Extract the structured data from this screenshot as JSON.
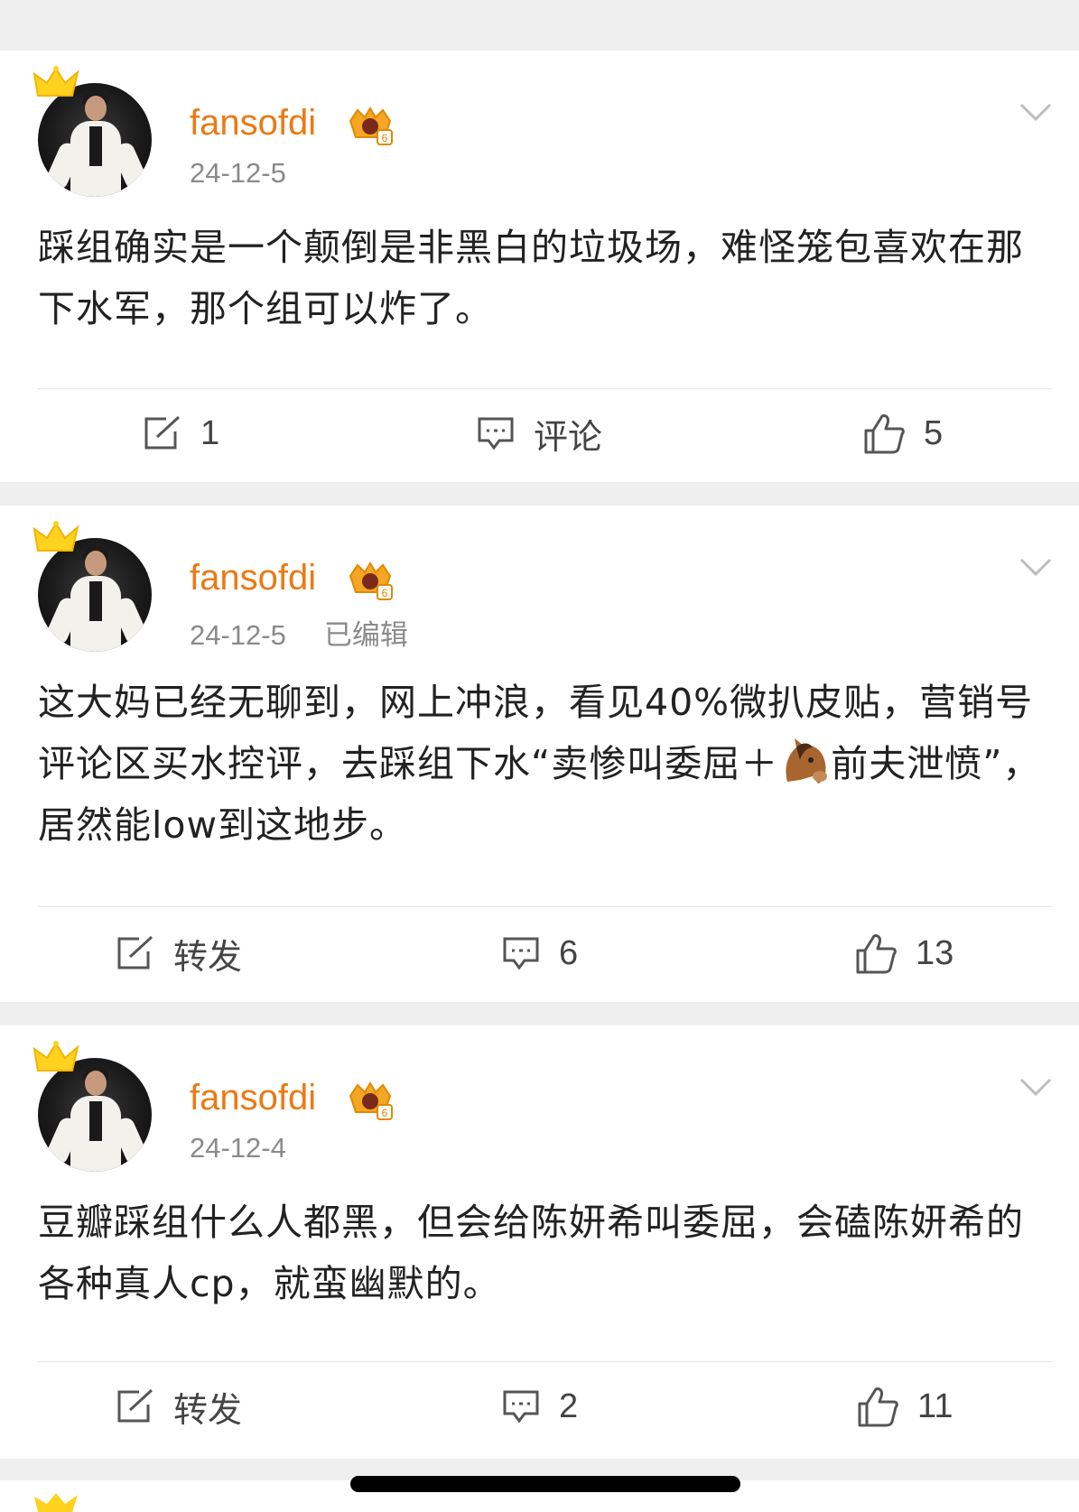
{
  "posts": [
    {
      "username": "fansofdi",
      "date": "24-12-5",
      "edited": "",
      "content": "踩组确实是一个颠倒是非黑白的垃圾场，难怪笼包喜欢在那下水军，那个组可以炸了。",
      "actions": {
        "repost": "1",
        "comment": "评论",
        "like": "5"
      }
    },
    {
      "username": "fansofdi",
      "date": "24-12-5",
      "edited": "已编辑",
      "content_before": "这大妈已经无聊到，网上冲浪，看见40%微扒皮贴，营销号评论区买水控评，去踩组下水“卖惨叫委屈＋",
      "content_after": "前夫泄愤”，居然能low到这地步。",
      "actions": {
        "repost": "转发",
        "comment": "6",
        "like": "13"
      }
    },
    {
      "username": "fansofdi",
      "date": "24-12-4",
      "edited": "",
      "content": "豆瓣踩组什么人都黑，但会给陈妍希叫委屈，会磕陈妍希的各种真人cp，就蛮幽默的。",
      "actions": {
        "repost": "转发",
        "comment": "2",
        "like": "11"
      }
    }
  ],
  "colors": {
    "username": "#eb7a14",
    "meta": "#8a8a8a",
    "text": "#222222",
    "separator": "#efefef"
  },
  "icons": [
    "crown-icon",
    "vip-badge-icon",
    "chevron-down-icon",
    "repost-icon",
    "comment-icon",
    "like-icon",
    "horse-emoji"
  ]
}
